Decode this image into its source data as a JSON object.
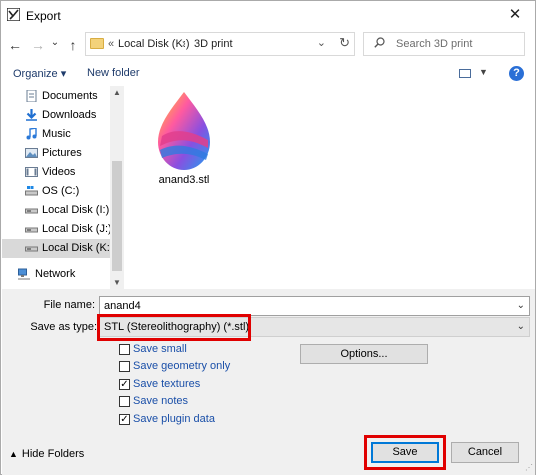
{
  "window": {
    "title": "Export",
    "close_glyph": "✕"
  },
  "nav": {
    "back_glyph": "←",
    "forward_glyph": "→",
    "recent_glyph": "⌄",
    "up_glyph": "↑"
  },
  "address": {
    "chevron": "«",
    "segments": [
      "Local Disk (K:)",
      "3D print"
    ],
    "separator": "›",
    "dropdown_glyph": "⌄",
    "refresh_glyph": "↻"
  },
  "search": {
    "placeholder": "Search 3D print"
  },
  "toolbar": {
    "organize_label": "Organize ▾",
    "new_folder_label": "New folder",
    "view_drop_glyph": "▼",
    "help_glyph": "?"
  },
  "sidebar": {
    "items": [
      {
        "label": "Documents",
        "icon": "documents-icon"
      },
      {
        "label": "Downloads",
        "icon": "downloads-icon"
      },
      {
        "label": "Music",
        "icon": "music-icon"
      },
      {
        "label": "Pictures",
        "icon": "pictures-icon"
      },
      {
        "label": "Videos",
        "icon": "videos-icon"
      },
      {
        "label": "OS (C:)",
        "icon": "os-drive-icon"
      },
      {
        "label": "Local Disk (I:)",
        "icon": "drive-icon"
      },
      {
        "label": "Local Disk (J:)",
        "icon": "drive-icon"
      },
      {
        "label": "Local Disk (K:)",
        "icon": "drive-icon",
        "selected": true
      },
      {
        "label": "Network",
        "icon": "network-icon"
      }
    ],
    "scroll_up_glyph": "▲",
    "scroll_down_glyph": "▼"
  },
  "files": [
    {
      "name": "anand3.stl",
      "icon": "paint3d-file-icon"
    }
  ],
  "form": {
    "file_name_label": "File name:",
    "file_name_value": "anand4",
    "save_type_label": "Save as type:",
    "save_type_value": "STL (Stereolithography) (*.stl)",
    "combo_arrow": "⌄",
    "options_label": "Options...",
    "checkboxes": [
      {
        "label": "Save small",
        "checked": false
      },
      {
        "label": "Save geometry only",
        "checked": false
      },
      {
        "label": "Save textures",
        "checked": true
      },
      {
        "label": "Save notes",
        "checked": false
      },
      {
        "label": "Save plugin data",
        "checked": true
      }
    ],
    "check_glyph": "✓"
  },
  "footer": {
    "hide_folders_label": "Hide Folders",
    "hide_caret": "▲",
    "save_label": "Save",
    "cancel_label": "Cancel"
  },
  "colors": {
    "highlight": "#e00000",
    "link_blue": "#1a4fa8",
    "selection_gray": "#d9d9d9"
  }
}
